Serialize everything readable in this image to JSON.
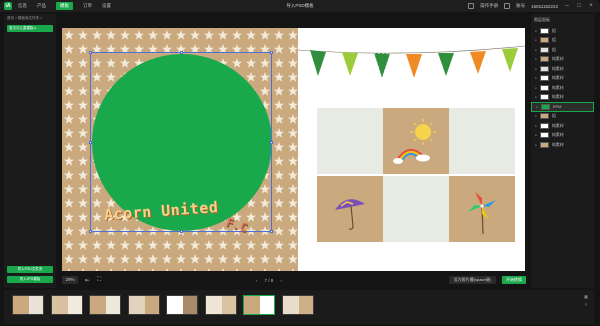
{
  "titlebar": {
    "logo": "iA",
    "menu": [
      "信息",
      "产品",
      "模板",
      "订单",
      "设置"
    ],
    "active_menu_index": 2,
    "window_title": "导入PSD模板",
    "help_label": "操作手册",
    "account_label": "账号",
    "phone": "16811152222"
  },
  "left_panel": {
    "breadcrumb": "首页 > 模板库文件夹 >",
    "tab_label": "宝贝与儿童模板 ▸",
    "import_psd_label": "导入PSD文件夹",
    "import_jpg_label": "导入JPG模板"
  },
  "canvas": {
    "text_main": "Acorn United",
    "text_small": "F.C",
    "colors": {
      "green": "#1aa84c",
      "kraft": "#c9a97d",
      "pale": "#e8ebe4"
    }
  },
  "bottom_bar": {
    "zoom": "29%",
    "prev": "‹",
    "page": "7 / 8",
    "next": "›",
    "hint_label": "设为照片槽(space键)",
    "start_label": "开始转换"
  },
  "right_panel": {
    "title": "图层面板",
    "layers": [
      {
        "label": "组",
        "thumb": "#ffffff"
      },
      {
        "label": "组",
        "thumb": "#c9a97d"
      },
      {
        "label": "组",
        "thumb": "#e5e0d8"
      },
      {
        "label": "纯素材",
        "thumb": "#c9a97d"
      },
      {
        "label": "纯素材",
        "thumb": "#e5e0d8"
      },
      {
        "label": "纯素材",
        "thumb": "#ffffff"
      },
      {
        "label": "纯素材",
        "thumb": "#ffffff"
      },
      {
        "label": "纯素材",
        "thumb": "#ffffff"
      },
      {
        "label": "EPM",
        "thumb": "#1aa84c",
        "selected": true
      },
      {
        "label": "组",
        "thumb": "#c9a97d"
      },
      {
        "label": "纯素材",
        "thumb": "#ffffff"
      },
      {
        "label": "纯素材",
        "thumb": "#ffffff"
      },
      {
        "label": "纯素材",
        "thumb": "#c9a97d"
      }
    ]
  },
  "filmstrip": {
    "thumbs": [
      {
        "left": "#c9a97d",
        "right": "#e9e2d6"
      },
      {
        "left": "#d9c1a2",
        "right": "#f1ebe0"
      },
      {
        "left": "#c9a97d",
        "right": "#ede7dc"
      },
      {
        "left": "#e1d2bd",
        "right": "#c9a97d"
      },
      {
        "left": "#ffffff",
        "right": "#a88c6a"
      },
      {
        "left": "#efe6d5",
        "right": "#d8c3a3"
      },
      {
        "left": "#c9a97d",
        "right": "#ffffff",
        "active": true
      },
      {
        "left": "#e8ddcb",
        "right": "#cdb08a"
      }
    ]
  }
}
